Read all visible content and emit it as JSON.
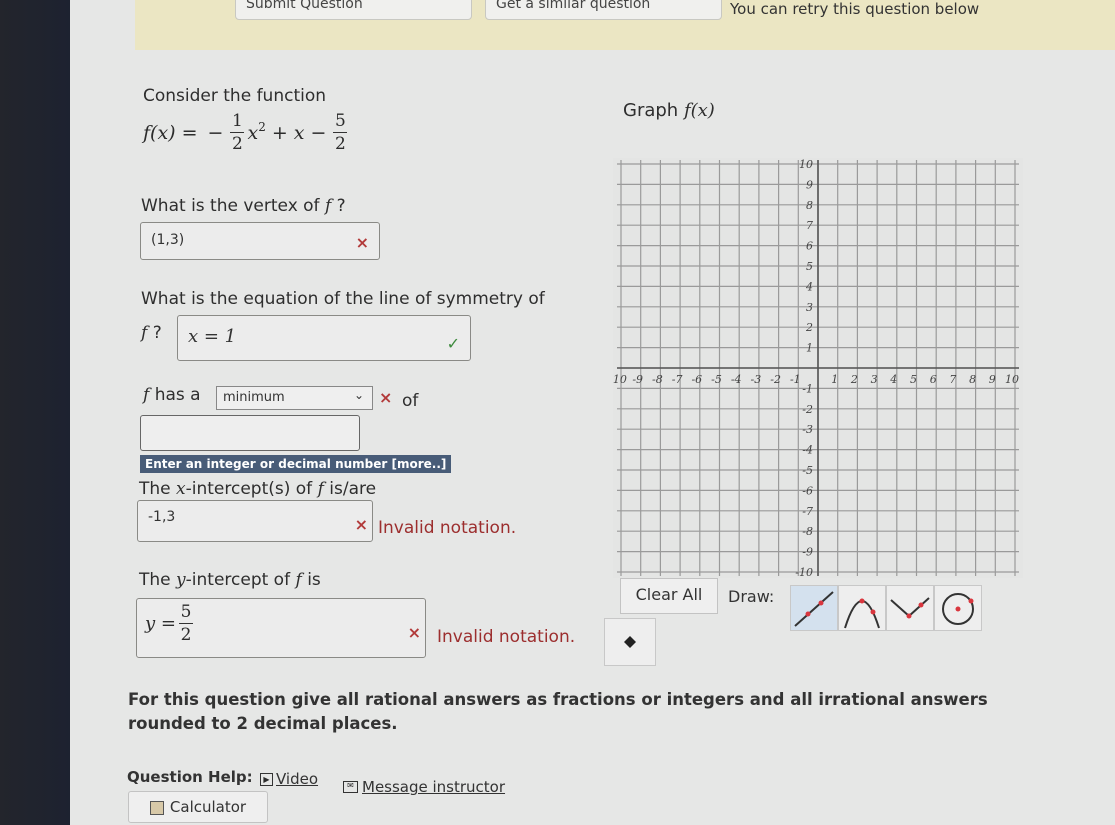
{
  "banner": {
    "button1_label": "Submit Question",
    "button2_label": "Get a similar question",
    "message": "You can retry this question below"
  },
  "question": {
    "intro": "Consider the function",
    "function_lhs": "f(x) =",
    "function_terms": {
      "lead_sign": "−",
      "a_num": "1",
      "a_den": "2",
      "x2": "x",
      "exp": "2",
      "plus": "+",
      "x": "x",
      "minus": "−",
      "c_num": "5",
      "c_den": "2"
    },
    "graph_label": "Graph",
    "graph_label_math": "f(x)",
    "vertex": {
      "prompt": "What is the vertex of",
      "prompt_var": "f",
      "prompt_end": "?",
      "value": "(1,3)",
      "status": "incorrect",
      "status_icon": "×"
    },
    "symmetry": {
      "prompt": "What is the equation of the line of symmetry of",
      "prompt_var": "f",
      "prompt_end": "?",
      "value": "x = 1",
      "status": "correct",
      "status_icon": "✓"
    },
    "extremum": {
      "prefix_var": "f",
      "prefix": "has a",
      "selected": "minimum",
      "status_icon": "×",
      "suffix": "of",
      "value": "",
      "hint": "Enter an integer or decimal number [more..]"
    },
    "x_intercepts": {
      "prompt_pre": "The",
      "prompt_var": "x",
      "prompt_mid": "-intercept(s) of",
      "prompt_var2": "f",
      "prompt_end": "is/are",
      "value": "-1,3",
      "status_icon": "×",
      "error": "Invalid notation."
    },
    "y_intercept": {
      "prompt_pre": "The",
      "prompt_var": "y",
      "prompt_mid": "-intercept of",
      "prompt_var2": "f",
      "prompt_end": "is",
      "value_lhs": "y =",
      "value_num": "5",
      "value_den": "2",
      "status_icon": "×",
      "error": "Invalid notation."
    },
    "instructions": "For this question give all rational answers as fractions or integers and all irrational answers rounded to 2 decimal places."
  },
  "graph": {
    "x_range": [
      -10,
      10
    ],
    "y_range": [
      -10,
      10
    ],
    "x_ticks": [
      "-10",
      "-9",
      "-8",
      "-7",
      "-6",
      "-5",
      "-4",
      "-3",
      "-2",
      "-1",
      "1",
      "2",
      "3",
      "4",
      "5",
      "6",
      "7",
      "8",
      "9",
      "10"
    ],
    "y_ticks": [
      "10",
      "9",
      "8",
      "7",
      "6",
      "5",
      "4",
      "3",
      "2",
      "1",
      "-1",
      "-2",
      "-3",
      "-4",
      "-5",
      "-6",
      "-7",
      "-8",
      "-9",
      "-10"
    ]
  },
  "draw_tools": {
    "clear_label": "Clear All",
    "draw_label": "Draw:",
    "tools": [
      {
        "name": "line",
        "icon": "line-tool-icon",
        "selected": true
      },
      {
        "name": "parabola-down",
        "icon": "parabola-tool-icon",
        "selected": false
      },
      {
        "name": "absolute-value",
        "icon": "absolute-value-tool-icon",
        "selected": false
      },
      {
        "name": "circle",
        "icon": "circle-tool-icon",
        "selected": false
      },
      {
        "name": "point",
        "icon": "point-tool-icon",
        "selected": false
      }
    ]
  },
  "help": {
    "label": "Question Help:",
    "video": "Video",
    "message": "Message instructor",
    "calculator": "Calculator"
  }
}
